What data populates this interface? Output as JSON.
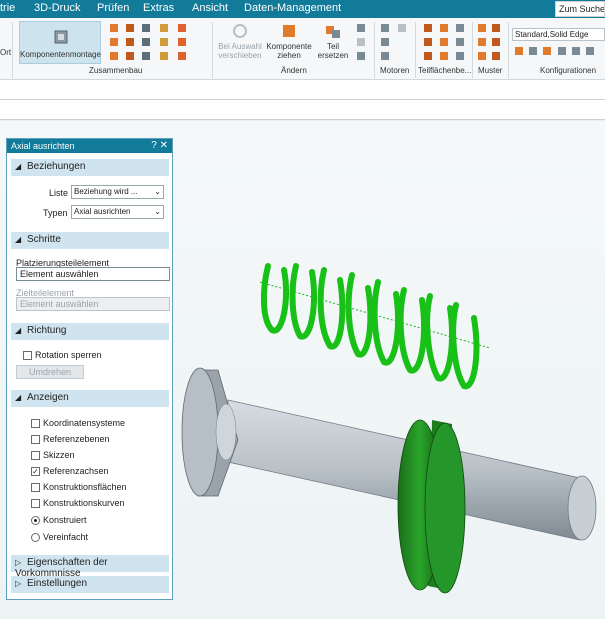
{
  "menu": [
    "trie",
    "3D-Druck",
    "Prüfen",
    "Extras",
    "Ansicht",
    "Daten-Management"
  ],
  "search_label": "Zum Suchen",
  "ribbon": {
    "ort_label": "Ort",
    "komponentenmontage": "Komponentenmontage",
    "zusammenbau_label": "Zusammenbau",
    "bei_auswahl": "Bei Auswahl verschieben",
    "komponente_ziehen": "Komponente ziehen",
    "teil_ersetzen": "Teil ersetzen",
    "aendern_label": "Ändern",
    "motoren_label": "Motoren",
    "teilflaechen_label": "Teilflächenbe...",
    "muster_label": "Muster",
    "konfigurationen_label": "Konfigurationen",
    "config_value": "Standard,Solid Edge"
  },
  "panel": {
    "title": "Axial ausrichten",
    "title_icons": "? ✕",
    "beziehungen": "Beziehungen",
    "liste_label": "Liste",
    "liste_value": "Beziehung wird ...",
    "typen_label": "Typen",
    "typen_value": "Axial ausrichten",
    "schritte": "Schritte",
    "platzierung_label": "Platzierungsteilelement",
    "platzierung_value": "Element auswählen",
    "ziel_label": "Zielteilelement",
    "ziel_value": "Element auswählen",
    "richtung": "Richtung",
    "rotation_sperren": "Rotation sperren",
    "umdrehen": "Umdrehen",
    "anzeigen": "Anzeigen",
    "options": [
      {
        "label": "Koordinatensysteme",
        "checked": false
      },
      {
        "label": "Referenzebenen",
        "checked": false
      },
      {
        "label": "Skizzen",
        "checked": false
      },
      {
        "label": "Referenzachsen",
        "checked": true
      },
      {
        "label": "Konstruktionsflächen",
        "checked": false
      },
      {
        "label": "Konstruktionskurven",
        "checked": false
      }
    ],
    "radio_konstruiert": "Konstruiert",
    "radio_vereinfacht": "Vereinfacht",
    "eigenschaften": "Eigenschaften der Vorkommnisse",
    "einstellungen": "Einstellungen"
  },
  "colors": {
    "accent": "#137b9a",
    "section_bg": "#cfe4ee",
    "spring_green": "#18c018",
    "part_green": "#1f7d1f",
    "shaft_gray": "#b7bfc6"
  }
}
